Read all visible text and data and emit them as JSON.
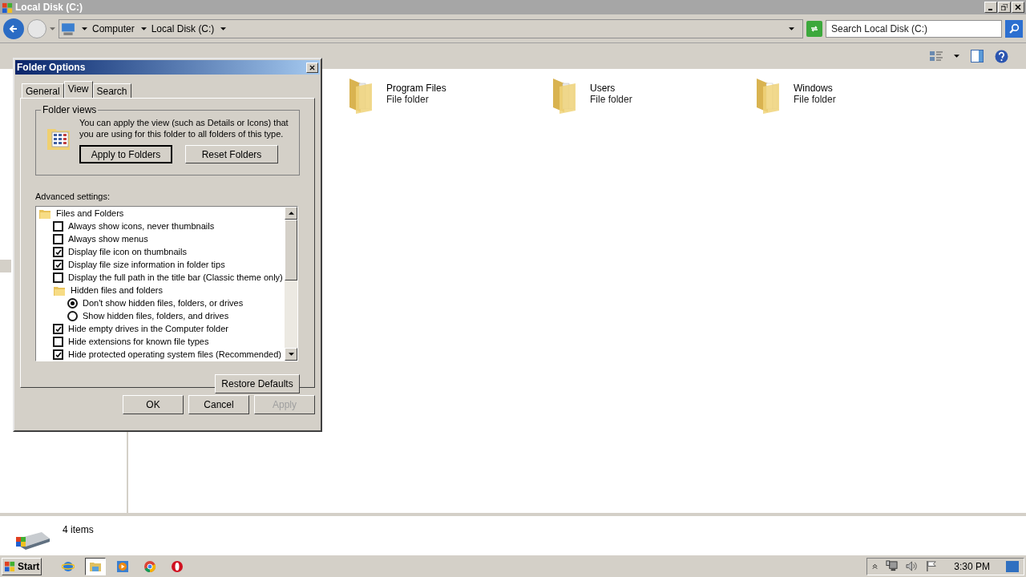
{
  "window": {
    "title": "Local Disk (C:)"
  },
  "breadcrumb": [
    "Computer",
    "Local Disk (C:)"
  ],
  "search": {
    "placeholder": "Search Local Disk (C:)"
  },
  "items": [
    {
      "name": "Program Files",
      "type": "File folder"
    },
    {
      "name": "Users",
      "type": "File folder"
    },
    {
      "name": "Windows",
      "type": "File folder"
    }
  ],
  "status": {
    "count": "4 items"
  },
  "dialog": {
    "title": "Folder Options",
    "tabs": [
      {
        "label": "General",
        "selected": false
      },
      {
        "label": "View",
        "selected": true
      },
      {
        "label": "Search",
        "selected": false
      }
    ],
    "group_title": "Folder views",
    "description": "You can apply the view (such as Details or Icons) that you are using for this folder to all folders of this type.",
    "view_buttons": [
      {
        "label": "Apply to Folders",
        "default": true
      },
      {
        "label": "Reset Folders",
        "default": false
      }
    ],
    "advanced_label": "Advanced settings:",
    "tree": [
      {
        "kind": "folder",
        "label": "Files and Folders",
        "children": [
          {
            "kind": "checkbox",
            "label": "Always show icons, never thumbnails",
            "checked": false
          },
          {
            "kind": "checkbox",
            "label": "Always show menus",
            "checked": false
          },
          {
            "kind": "checkbox",
            "label": "Display file icon on thumbnails",
            "checked": true
          },
          {
            "kind": "checkbox",
            "label": "Display file size information in folder tips",
            "checked": true
          },
          {
            "kind": "checkbox",
            "label": "Display the full path in the title bar (Classic theme only)",
            "checked": false
          },
          {
            "kind": "folder",
            "label": "Hidden files and folders",
            "children": [
              {
                "kind": "radio",
                "label": "Don't show hidden files, folders, or drives",
                "selected": true
              },
              {
                "kind": "radio",
                "label": "Show hidden files, folders, and drives",
                "selected": false
              }
            ]
          },
          {
            "kind": "checkbox",
            "label": "Hide empty drives in the Computer folder",
            "checked": true
          },
          {
            "kind": "checkbox",
            "label": "Hide extensions for known file types",
            "checked": false
          },
          {
            "kind": "checkbox",
            "label": "Hide protected operating system files (Recommended)",
            "checked": true
          }
        ]
      }
    ],
    "restore_button": "Restore Defaults",
    "footer_buttons": [
      {
        "label": "OK",
        "disabled": false
      },
      {
        "label": "Cancel",
        "disabled": false
      },
      {
        "label": "Apply",
        "disabled": true
      }
    ]
  },
  "taskbar": {
    "start": "Start",
    "apps": [
      {
        "kind": "browser-e",
        "selected": false
      },
      {
        "kind": "explorer",
        "selected": true
      },
      {
        "kind": "player",
        "selected": false
      },
      {
        "kind": "chrome",
        "selected": false
      },
      {
        "kind": "opera",
        "selected": false
      }
    ],
    "clock": "3:30 PM"
  }
}
